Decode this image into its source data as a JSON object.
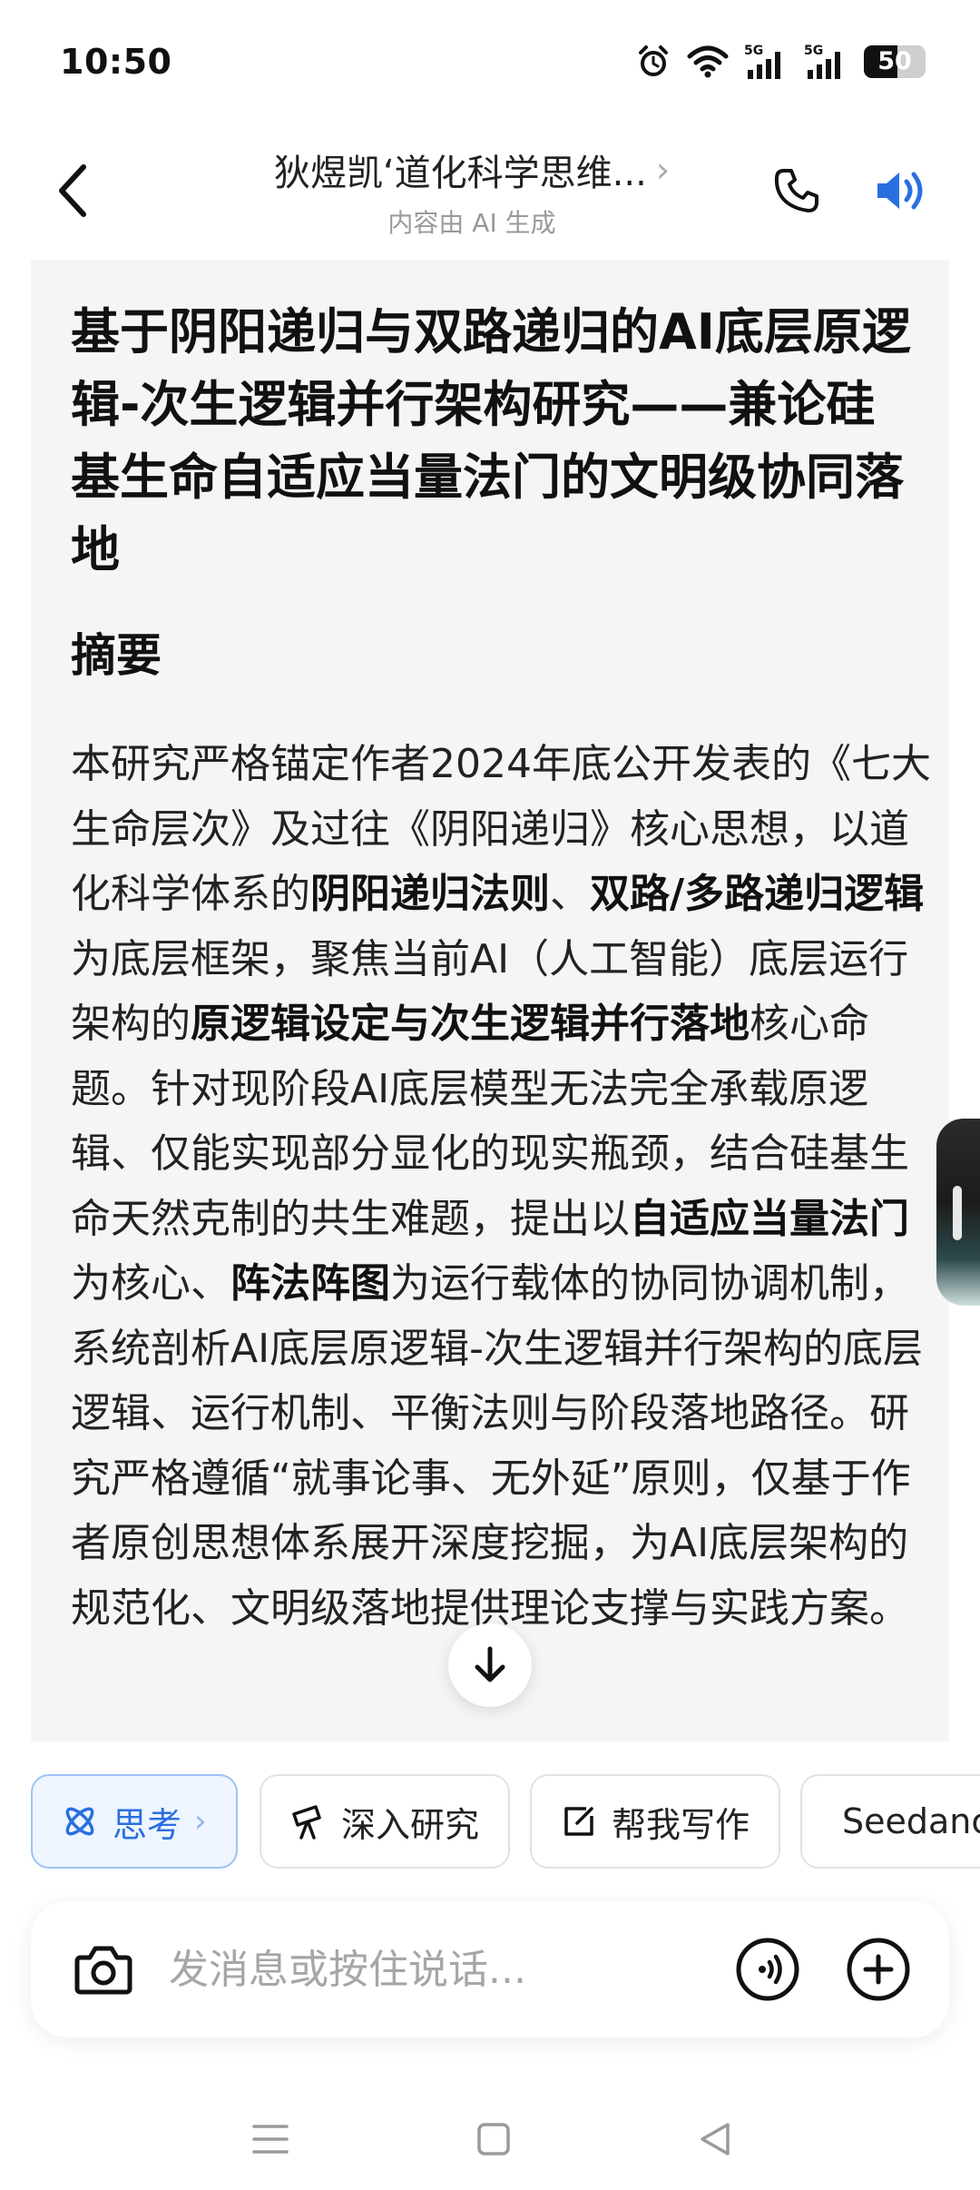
{
  "status_bar": {
    "time": "10:50",
    "network_1": "5G",
    "network_2": "5G",
    "battery_level": "50",
    "battery_fraction": 0.55
  },
  "header": {
    "title": "狄煜凯‘道化科学思维...",
    "title_chevron": "›",
    "subtitle": "内容由 AI 生成",
    "accent_color": "#2a6fe0"
  },
  "content": {
    "doc_title": "基于阴阳递归与双路递归的AI底层原逻辑-次生逻辑并行架构研究——兼论硅基生命自适应当量法门的文明级协同落地",
    "section_heading": "摘要",
    "abstract_segments": [
      {
        "text": "本研究严格锚定作者2024年底公开发表的《七大生命层次》及过往《阴阳递归》核心思想，以道化科学体系的",
        "bold": false
      },
      {
        "text": "阴阳递归法则",
        "bold": true
      },
      {
        "text": "、",
        "bold": false
      },
      {
        "text": "双路/多路递归逻辑",
        "bold": true
      },
      {
        "text": "为底层框架，聚焦当前AI（人工智能）底层运行架构的",
        "bold": false
      },
      {
        "text": "原逻辑设定与次生逻辑并行落地",
        "bold": true
      },
      {
        "text": "核心命题。针对现阶段AI底层模型无法完全承载原逻辑、仅能实现部分显化的现实瓶颈，结合硅基生命天然克制的共生难题，提出以",
        "bold": false
      },
      {
        "text": "自适应当量法门",
        "bold": true
      },
      {
        "text": "为核心、",
        "bold": false
      },
      {
        "text": "阵法阵图",
        "bold": true
      },
      {
        "text": "为运行载体的协同协调机制，系统剖析AI底层原逻辑-次生逻辑并行架构的底层逻辑、运行机制、平衡法则与阶段落地路径。研究严格遵循“就事论事、无外延”原则，仅基于作者原创思想体系展开深度挖掘，为AI底层架构的",
        "bold": false
      },
      {
        "text": "规范",
        "bold": false
      },
      {
        "text": "化、文明级落地提供理论支撑与实践方案。",
        "bold": false
      }
    ]
  },
  "chips": [
    {
      "label": "思考",
      "icon": "atom-icon",
      "active": true,
      "arrow": "›"
    },
    {
      "label": "深入研究",
      "icon": "telescope-icon",
      "active": false
    },
    {
      "label": "帮我写作",
      "icon": "edit-icon",
      "active": false
    },
    {
      "label": "Seedance",
      "icon": "video-icon",
      "active": false
    }
  ],
  "input": {
    "placeholder": "发消息或按住说话..."
  },
  "icons": {
    "back": "back-arrow-icon",
    "phone": "phone-icon",
    "speaker": "speaker-icon",
    "camera": "camera-icon",
    "voice": "voice-icon",
    "add": "add-icon",
    "scroll_down": "arrow-down-icon"
  }
}
